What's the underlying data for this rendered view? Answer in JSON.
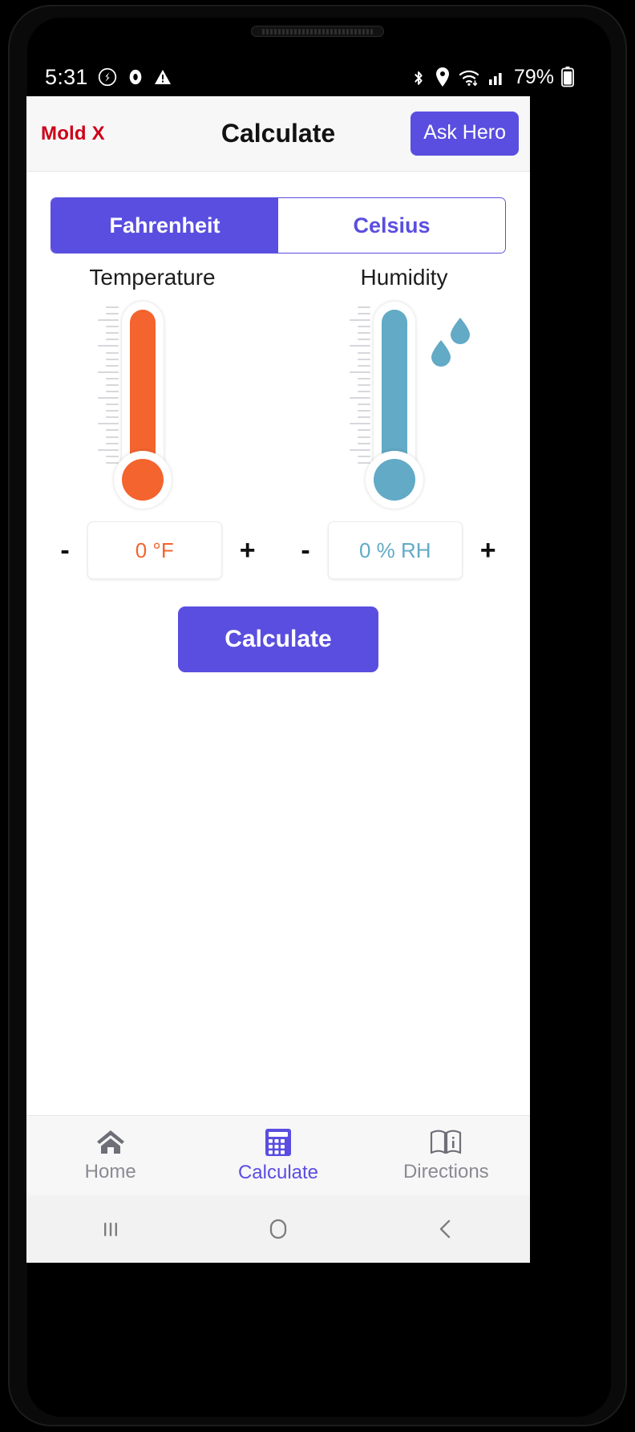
{
  "status_bar": {
    "time": "5:31",
    "battery": "79%",
    "left_icons": [
      "dnd-icon",
      "record-icon",
      "warning-icon"
    ],
    "right_icons": [
      "bluetooth-icon",
      "location-icon",
      "wifi-icon",
      "cellular-signal-icon",
      "battery-icon"
    ]
  },
  "header": {
    "brand": "Mold X",
    "brand_color": "#cc0018",
    "title": "Calculate",
    "ask_hero_label": "Ask Hero",
    "accent_color": "#5a4ee0"
  },
  "unit_toggle": {
    "options": [
      {
        "label": "Fahrenheit",
        "active": true
      },
      {
        "label": "Celsius",
        "active": false
      }
    ]
  },
  "gauges": [
    {
      "label": "Temperature",
      "icon": "thermometer-icon",
      "color": "#f4642e",
      "value": "0 °F",
      "decrement_label": "-",
      "increment_label": "+"
    },
    {
      "label": "Humidity",
      "icon": "hygrometer-icon",
      "color": "#62aac6",
      "value": "0 % RH",
      "decrement_label": "-",
      "increment_label": "+"
    }
  ],
  "calculate_button": {
    "label": "Calculate"
  },
  "bottom_nav": {
    "items": [
      {
        "label": "Home",
        "icon": "house-icon",
        "active": false
      },
      {
        "label": "Calculate",
        "icon": "calculator-icon",
        "active": true
      },
      {
        "label": "Directions",
        "icon": "book-info-icon",
        "active": false
      }
    ]
  },
  "system_nav": {
    "items": [
      {
        "icon": "recent-apps-icon"
      },
      {
        "icon": "home-circle-icon"
      },
      {
        "icon": "back-chevron-icon"
      }
    ]
  }
}
